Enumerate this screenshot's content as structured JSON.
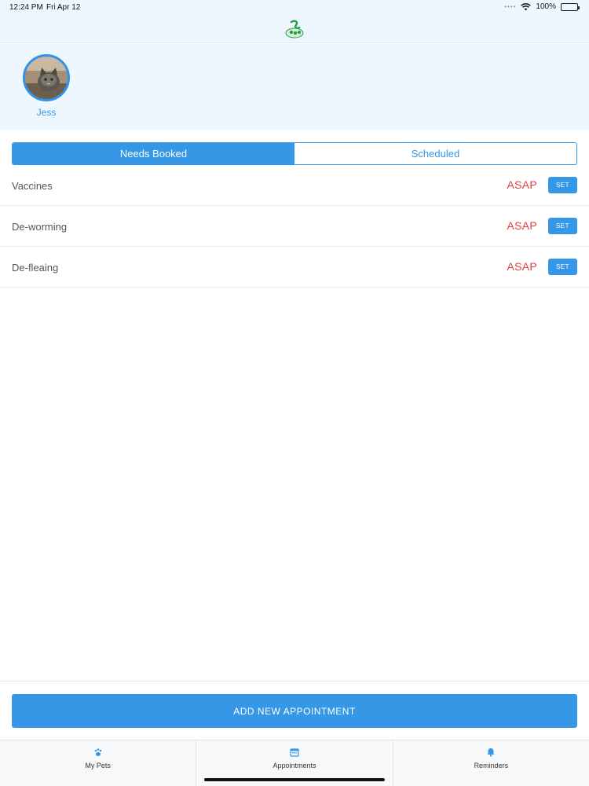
{
  "status_bar": {
    "time": "12:24 PM",
    "date": "Fri Apr 12",
    "battery": "100%"
  },
  "pet": {
    "name": "Jess"
  },
  "segments": [
    {
      "label": "Needs Booked",
      "active": true
    },
    {
      "label": "Scheduled",
      "active": false
    }
  ],
  "appointments": [
    {
      "label": "Vaccines",
      "due": "ASAP",
      "action": "SET"
    },
    {
      "label": "De-worming",
      "due": "ASAP",
      "action": "SET"
    },
    {
      "label": "De-fleaing",
      "due": "ASAP",
      "action": "SET"
    }
  ],
  "add_button": {
    "label": "ADD NEW APPOINTMENT"
  },
  "tabs": [
    {
      "label": "My Pets",
      "icon": "paw-icon"
    },
    {
      "label": "Appointments",
      "icon": "calendar-icon"
    },
    {
      "label": "Reminders",
      "icon": "bell-icon"
    }
  ],
  "colors": {
    "accent": "#3597e6",
    "due": "#e23e3e",
    "header_bg": "#eff7fe"
  }
}
